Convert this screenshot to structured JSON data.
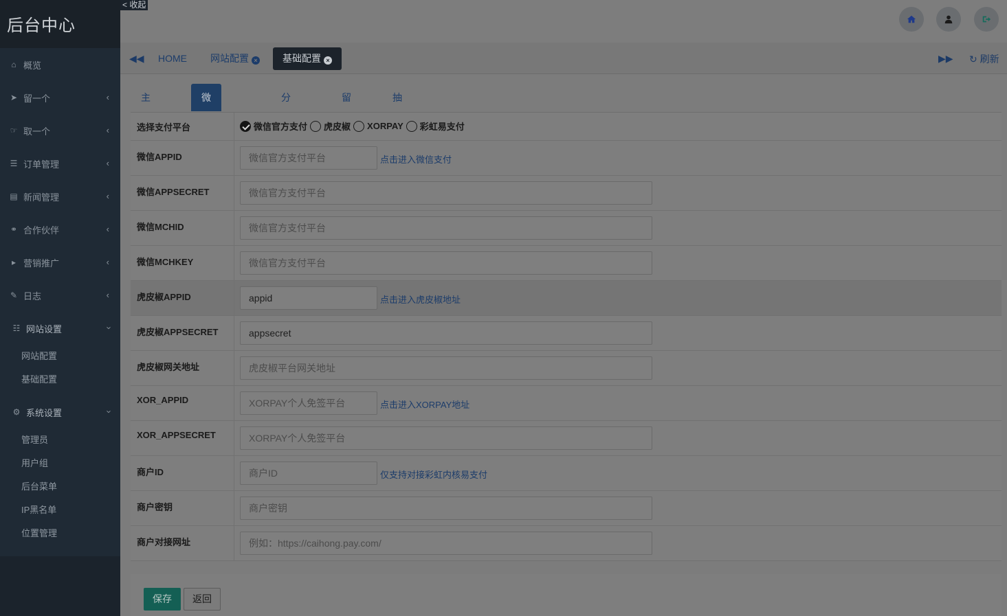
{
  "sidebar": {
    "brand": "后台中心",
    "items": [
      {
        "label": "概览",
        "icon": "home-icon"
      },
      {
        "label": "留一个",
        "icon": "paper-plane-icon"
      },
      {
        "label": "取一个",
        "icon": "hand-icon"
      },
      {
        "label": "订单管理",
        "icon": "list-icon"
      },
      {
        "label": "新闻管理",
        "icon": "newspaper-icon"
      },
      {
        "label": "合作伙伴",
        "icon": "handshake-icon"
      },
      {
        "label": "营销推广",
        "icon": "bullhorn-icon"
      },
      {
        "label": "日志",
        "icon": "edit-icon"
      }
    ],
    "website_settings": {
      "label": "网站设置",
      "children": [
        "网站配置",
        "基础配置"
      ]
    },
    "system_settings": {
      "label": "系统设置",
      "children": [
        "管理员",
        "用户组",
        "后台菜单",
        "IP黑名单",
        "位置管理"
      ]
    }
  },
  "collapse_label": "< 收起",
  "tabs": {
    "items": [
      {
        "label": "HOME"
      },
      {
        "label": "网站配置"
      },
      {
        "label": "基础配置"
      }
    ],
    "refresh_label": "刷新"
  },
  "subtabs": [
    "主站相关",
    "微信支付相关",
    "分销相关",
    "留一个",
    "抽一个"
  ],
  "form": {
    "platform_label": "选择支付平台",
    "platforms": [
      "微信官方支付",
      "虎皮椒",
      "XORPAY",
      "彩虹易支付"
    ],
    "selected_platform": "微信官方支付",
    "rows": [
      {
        "label": "微信APPID",
        "value": "",
        "placeholder": "微信官方支付平台",
        "link": "点击进入微信支付"
      },
      {
        "label": "微信APPSECRET",
        "value": "",
        "placeholder": "微信官方支付平台"
      },
      {
        "label": "微信MCHID",
        "value": "",
        "placeholder": "微信官方支付平台"
      },
      {
        "label": "微信MCHKEY",
        "value": "",
        "placeholder": "微信官方支付平台"
      },
      {
        "label": "虎皮椒APPID",
        "value": "appid",
        "placeholder": "",
        "link": "点击进入虎皮椒地址"
      },
      {
        "label": "虎皮椒APPSECRET",
        "value": "appsecret",
        "placeholder": ""
      },
      {
        "label": "虎皮椒网关地址",
        "value": "",
        "placeholder": "虎皮椒平台网关地址"
      },
      {
        "label": "XOR_APPID",
        "value": "",
        "placeholder": "XORPAY个人免签平台",
        "link": "点击进入XORPAY地址"
      },
      {
        "label": "XOR_APPSECRET",
        "value": "",
        "placeholder": "XORPAY个人免签平台"
      },
      {
        "label": "商户ID",
        "value": "",
        "placeholder": "商户ID",
        "link": "仅支持对接彩虹内核易支付"
      },
      {
        "label": "商户密钥",
        "value": "",
        "placeholder": "商户密钥"
      },
      {
        "label": "商户对接网址",
        "value": "",
        "placeholder": "例如：https://caihong.pay.com/"
      }
    ]
  },
  "buttons": {
    "save": "保存",
    "back": "返回"
  }
}
